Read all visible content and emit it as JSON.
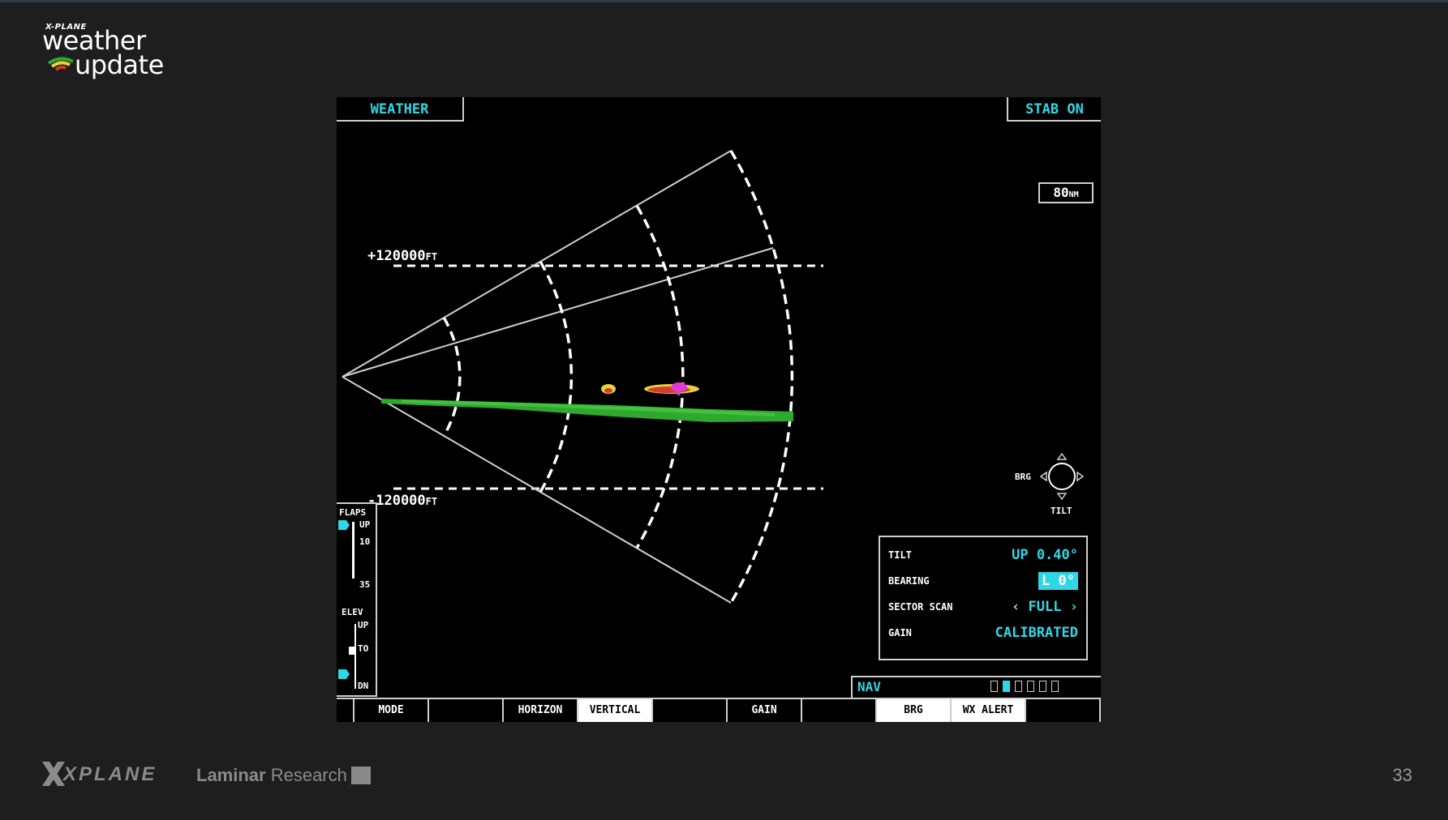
{
  "branding": {
    "logo_small": "X-PLANE",
    "logo_line1": "weather",
    "logo_line2": "update",
    "footer_logo": "XPLANE",
    "footer_company_bold": "Laminar",
    "footer_company_rest": " Research",
    "slide_number": "33"
  },
  "display": {
    "mode_title": "WEATHER",
    "stab_status": "STAB ON",
    "range_value": "80",
    "range_unit": "NM",
    "upper_altitude_value": "+120000",
    "lower_altitude_value": "-120000",
    "altitude_unit": "FT",
    "colors": {
      "cyan": "#2fd7e6",
      "line": "#cfcfcf",
      "green_return": "#2ea82e",
      "magenta_return": "#e23ad6",
      "yellow_return": "#e8d23a"
    }
  },
  "side_panel": {
    "flaps_label": "FLAPS",
    "flaps_up": "UP",
    "flaps_10": "10",
    "flaps_35": "35",
    "elev_label": "ELEV",
    "elev_up": "UP",
    "elev_to": "TO",
    "elev_dn": "DN"
  },
  "control": {
    "brg_label": "BRG",
    "tilt_label": "TILT"
  },
  "settings": {
    "tilt_label": "TILT",
    "tilt_value": "UP 0.40°",
    "bearing_label": "BEARING",
    "bearing_value": "L 0°",
    "sector_scan_label": "SECTOR SCAN",
    "sector_scan_value": "FULL",
    "gain_label": "GAIN",
    "gain_value": "CALIBRATED"
  },
  "nav": {
    "label": "NAV",
    "page_count": 6,
    "active_page": 2
  },
  "softkeys": {
    "mode": "MODE",
    "horizon": "HORIZON",
    "vertical": "VERTICAL",
    "gain": "GAIN",
    "brg": "BRG",
    "wx_alert": "WX ALERT"
  }
}
